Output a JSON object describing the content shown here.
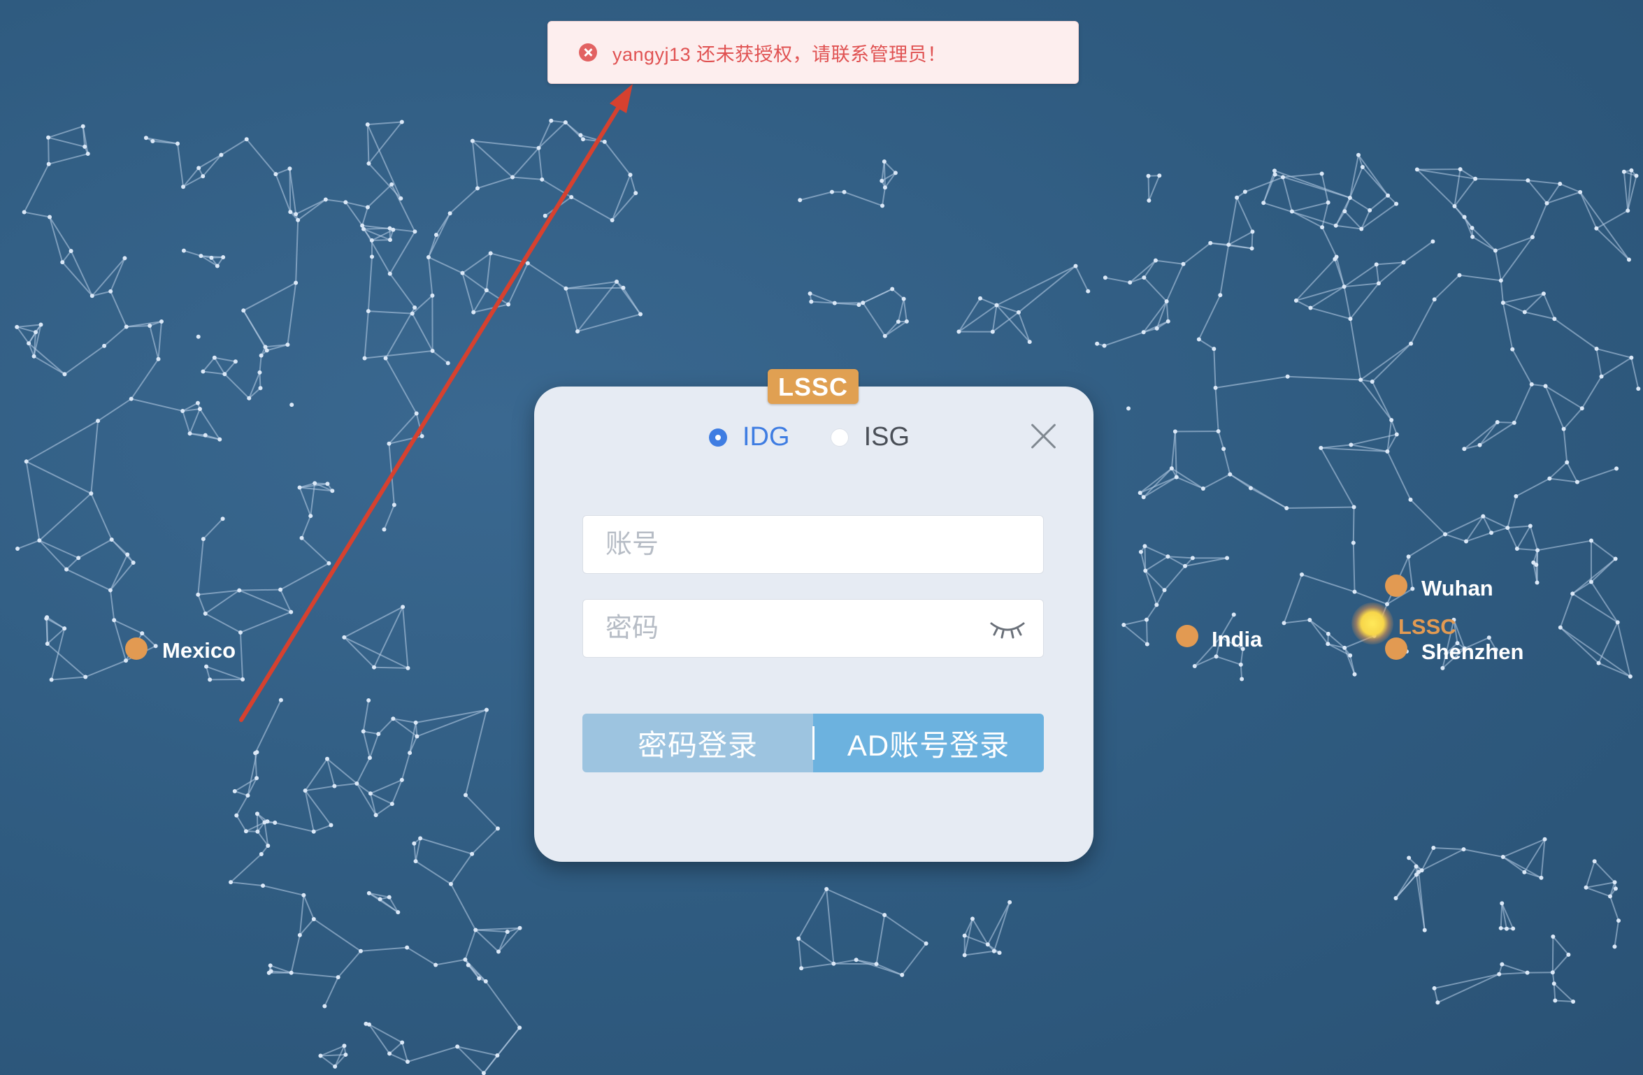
{
  "toast": {
    "message": "yangyj13 还未获授权，请联系管理员！"
  },
  "login": {
    "brand": "LSSC",
    "org_options": [
      {
        "label": "IDG",
        "selected": true
      },
      {
        "label": "ISG",
        "selected": false
      }
    ],
    "account_placeholder": "账号",
    "password_placeholder": "密码",
    "password_login_label": "密码登录",
    "ad_login_label": "AD账号登录"
  },
  "map": {
    "locations": [
      {
        "name": "Mexico"
      },
      {
        "name": "India"
      },
      {
        "name": "Wuhan"
      },
      {
        "name": "LSSC"
      },
      {
        "name": "Shenzhen"
      }
    ]
  },
  "colors": {
    "background": "#2f5b80",
    "accent_orange": "#e29a52",
    "annotation_arrow": "#d6412f",
    "radio_selected": "#3f7de2",
    "toast_text": "#e05252"
  }
}
